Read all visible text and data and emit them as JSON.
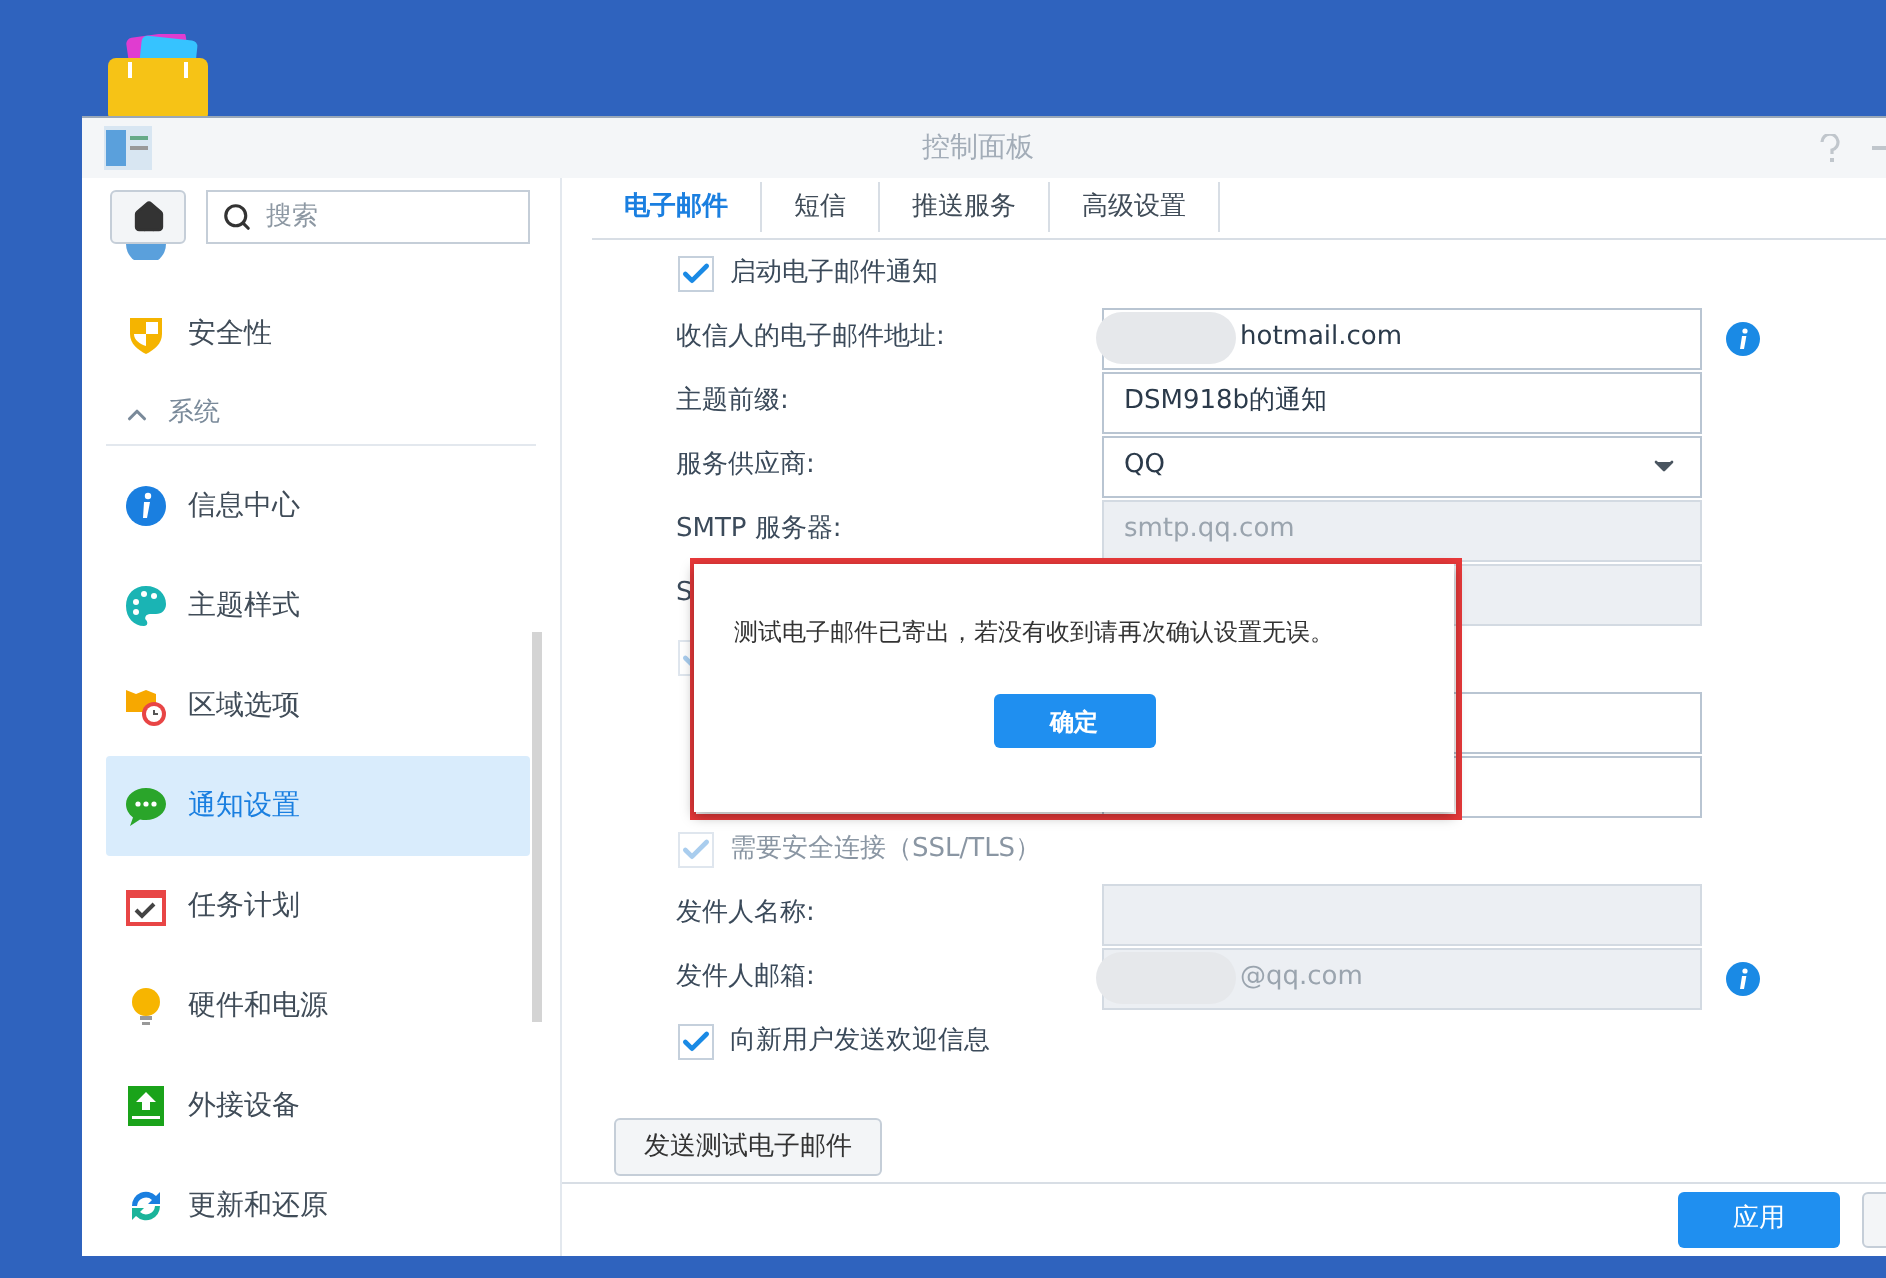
{
  "window": {
    "title": "控制面板"
  },
  "sidebar": {
    "search": {
      "placeholder": "搜索"
    },
    "items": [
      {
        "kind": "item",
        "label": "安全性",
        "selected": false
      },
      {
        "kind": "header",
        "label": "系统",
        "expanded": true
      },
      {
        "kind": "item",
        "label": "信息中心",
        "selected": false
      },
      {
        "kind": "item",
        "label": "主题样式",
        "selected": false
      },
      {
        "kind": "item",
        "label": "区域选项",
        "selected": false
      },
      {
        "kind": "item",
        "label": "通知设置",
        "selected": true
      },
      {
        "kind": "item",
        "label": "任务计划",
        "selected": false
      },
      {
        "kind": "item",
        "label": "硬件和电源",
        "selected": false
      },
      {
        "kind": "item",
        "label": "外接设备",
        "selected": false
      },
      {
        "kind": "item",
        "label": "更新和还原",
        "selected": false
      }
    ]
  },
  "tabs": [
    {
      "label": "电子邮件",
      "selected": true
    },
    {
      "label": "短信",
      "selected": false
    },
    {
      "label": "推送服务",
      "selected": false
    },
    {
      "label": "高级设置",
      "selected": false
    }
  ],
  "form": {
    "rows": [
      {
        "kind": "checkbox",
        "label": "启动电子邮件通知",
        "checked": true,
        "disabled": false
      },
      {
        "kind": "field",
        "label": "收信人的电子邮件地址:",
        "value": "hotmail.com",
        "redacted": true,
        "disabled": false,
        "info": true
      },
      {
        "kind": "field",
        "label": "主题前缀:",
        "value": "DSM918b的通知",
        "disabled": false
      },
      {
        "kind": "select",
        "label": "服务供应商:",
        "value": "QQ",
        "disabled": false
      },
      {
        "kind": "field",
        "label": "SMTP 服务器:",
        "value": "smtp.qq.com",
        "disabled": true
      },
      {
        "kind": "field",
        "label": "S",
        "disabled": true
      },
      {
        "kind": "checkbox",
        "checked": true,
        "disabled": true
      },
      {
        "kind": "field",
        "disabled": false
      },
      {
        "kind": "field",
        "disabled": false
      },
      {
        "kind": "checkbox",
        "label": "需要安全连接（SSL/TLS）",
        "checked": true,
        "disabled": true
      },
      {
        "kind": "field",
        "label": "发件人名称:",
        "disabled": true
      },
      {
        "kind": "field",
        "label": "发件人邮箱:",
        "value": "@qq.com",
        "redacted": true,
        "disabled": true,
        "info": true
      },
      {
        "kind": "checkbox",
        "label": "向新用户发送欢迎信息",
        "checked": true,
        "disabled": false
      }
    ]
  },
  "send_test_button": "发送测试电子邮件",
  "apply_button": "应用",
  "dialog": {
    "message": "测试电子邮件已寄出，若没有收到请再次确认设置无误。",
    "ok_button": "确定"
  }
}
